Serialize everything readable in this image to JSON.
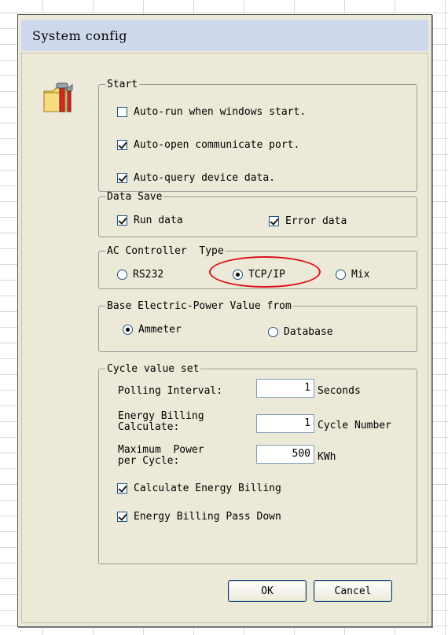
{
  "window": {
    "title": "System config"
  },
  "start": {
    "legend": "Start",
    "auto_run": {
      "label": "Auto-run when windows start.",
      "checked": false
    },
    "auto_open": {
      "label": "Auto-open communicate port.",
      "checked": true
    },
    "auto_query": {
      "label": "Auto-query device data.",
      "checked": true
    }
  },
  "data_save": {
    "legend": "Data Save",
    "run_data": {
      "label": "Run data",
      "checked": true
    },
    "error_data": {
      "label": "Error data",
      "checked": true
    }
  },
  "ac_controller": {
    "legend": "AC Controller  Type",
    "options": [
      {
        "label": "RS232",
        "selected": false
      },
      {
        "label": "TCP/IP",
        "selected": true
      },
      {
        "label": "Mix",
        "selected": false
      }
    ]
  },
  "base_power": {
    "legend": "Base Electric-Power Value from",
    "options": [
      {
        "label": "Ammeter",
        "selected": true
      },
      {
        "label": "Database",
        "selected": false
      }
    ]
  },
  "cycle": {
    "legend": "Cycle value set",
    "polling": {
      "label": "Polling Interval:",
      "value": "1",
      "unit": "Seconds"
    },
    "billing": {
      "label": "Energy Billing\nCalculate:",
      "value": "1",
      "unit": "Cycle Number"
    },
    "max_power": {
      "label": "Maximum  Power\nper Cycle:",
      "value": "500",
      "unit": "KWh"
    },
    "calc_billing": {
      "label": "Calculate Energy Billing",
      "checked": true
    },
    "pass_down": {
      "label": "Energy Billing Pass Down",
      "checked": true
    }
  },
  "buttons": {
    "ok": "OK",
    "cancel": "Cancel"
  },
  "colors": {
    "annotation": "#e0101a",
    "title_bar": "#cfd9ec",
    "dialog_bg": "#ece9d8"
  }
}
